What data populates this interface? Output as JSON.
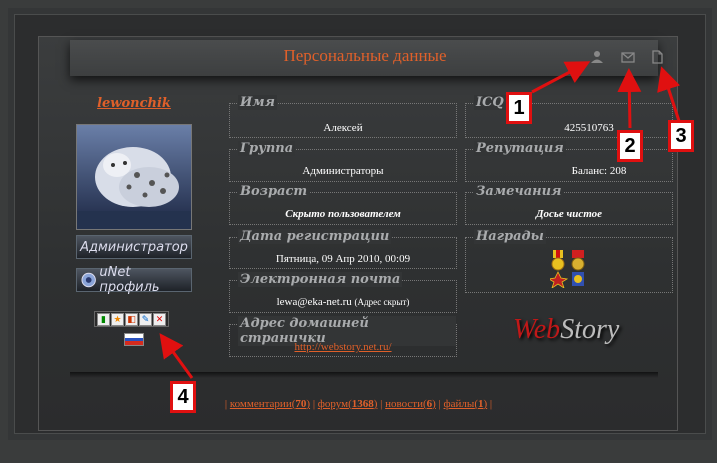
{
  "header": {
    "title": "Персональные данные",
    "icons": [
      "user-icon",
      "mail-icon",
      "document-icon"
    ]
  },
  "profile": {
    "username": "lewonchik",
    "role_button": "Администратор",
    "unet_button": "uNet профиль",
    "flag": "russia-flag"
  },
  "fields": {
    "name": {
      "label": "Имя",
      "value": "Алексей"
    },
    "group": {
      "label": "Группа",
      "value": "Администраторы"
    },
    "age": {
      "label": "Возраст",
      "value": "Скрыто пользователем"
    },
    "reg_date": {
      "label": "Дата регистрации",
      "value": "Пятница, 09 Апр 2010, 00:09"
    },
    "email": {
      "label": "Электронная почта",
      "value": "lewa@eka-net.ru",
      "note": "(Адрес скрыт)"
    },
    "homepage": {
      "label": "Адрес домашней странички",
      "value": "http://webstory.net.ru/"
    },
    "icq": {
      "label": "ICQ",
      "value": "425510763"
    },
    "reputation": {
      "label": "Репутация",
      "value": "Баланс: 208"
    },
    "remarks": {
      "label": "Замечания",
      "value": "Досье чистое"
    },
    "awards": {
      "label": "Награды"
    }
  },
  "logo": {
    "web": "Web",
    "story": "Story"
  },
  "stats": [
    {
      "label": "комментарии",
      "count": "70"
    },
    {
      "label": "форум",
      "count": "1368"
    },
    {
      "label": "новости",
      "count": "6"
    },
    {
      "label": "файлы",
      "count": "1"
    }
  ],
  "callouts": [
    "1",
    "2",
    "3",
    "4"
  ],
  "colors": {
    "accent": "#e0602a",
    "callout_border": "#e01010"
  }
}
